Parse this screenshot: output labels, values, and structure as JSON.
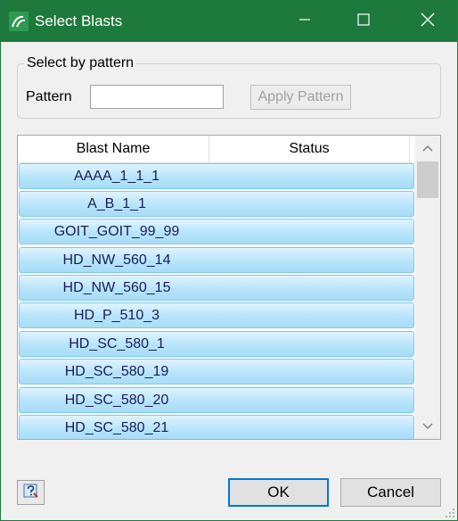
{
  "window": {
    "title": "Select Blasts",
    "icon": "app-logo-icon",
    "controls": [
      "minimize-icon",
      "maximize-icon",
      "close-icon"
    ]
  },
  "pattern_group": {
    "legend": "Select by pattern",
    "label": "Pattern",
    "input_value": "",
    "apply_label": "Apply Pattern"
  },
  "grid": {
    "columns": [
      "Blast Name",
      "Status"
    ],
    "rows": [
      {
        "name": "AAAA_1_1_1",
        "status": ""
      },
      {
        "name": "A_B_1_1",
        "status": ""
      },
      {
        "name": "GOIT_GOIT_99_99",
        "status": ""
      },
      {
        "name": "HD_NW_560_14",
        "status": ""
      },
      {
        "name": "HD_NW_560_15",
        "status": ""
      },
      {
        "name": "HD_P_510_3",
        "status": ""
      },
      {
        "name": "HD_SC_580_1",
        "status": ""
      },
      {
        "name": "HD_SC_580_19",
        "status": ""
      },
      {
        "name": "HD_SC_580_20",
        "status": ""
      },
      {
        "name": "HD_SC_580_21",
        "status": ""
      }
    ]
  },
  "footer": {
    "help_icon": "help-icon",
    "ok_label": "OK",
    "cancel_label": "Cancel"
  },
  "colors": {
    "titlebar": "#1e7a3c",
    "row_fill": "#b6e4fb",
    "row_border": "#7fc8ee",
    "default_button_border": "#0078d7"
  }
}
